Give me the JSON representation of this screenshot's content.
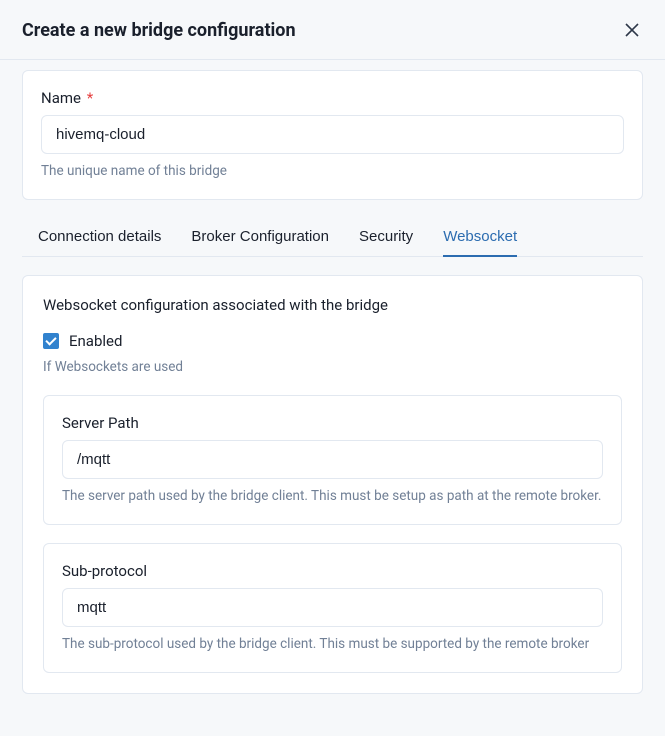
{
  "header": {
    "title": "Create a new bridge configuration"
  },
  "name_field": {
    "label": "Name",
    "required_marker": "*",
    "value": "hivemq-cloud",
    "helper": "The unique name of this bridge"
  },
  "tabs": [
    {
      "label": "Connection details",
      "active": false
    },
    {
      "label": "Broker Configuration",
      "active": false
    },
    {
      "label": "Security",
      "active": false
    },
    {
      "label": "Websocket",
      "active": true
    }
  ],
  "websocket_panel": {
    "title": "Websocket configuration associated with the bridge",
    "enabled": {
      "checked": true,
      "label": "Enabled",
      "helper": "If Websockets are used"
    },
    "server_path": {
      "label": "Server Path",
      "value": "/mqtt",
      "helper": "The server path used by the bridge client. This must be setup as path at the remote broker."
    },
    "sub_protocol": {
      "label": "Sub-protocol",
      "value": "mqtt",
      "helper": "The sub-protocol used by the bridge client. This must be supported by the remote broker"
    }
  }
}
